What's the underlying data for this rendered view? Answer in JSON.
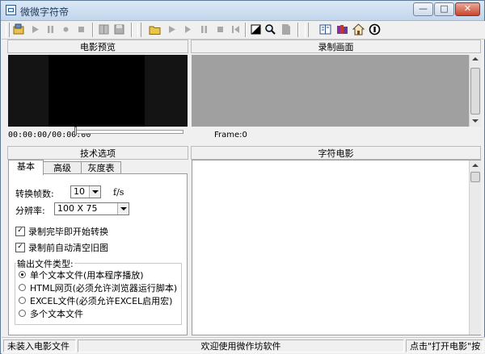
{
  "window": {
    "title": "微微字符帝"
  },
  "toolbar": {
    "left_group": [
      "open-video-icon",
      "play-icon",
      "pause-icon",
      "record-icon",
      "stop-icon",
      "grid-view-icon",
      "save-icon"
    ],
    "middle_group": [
      "open-folder-icon",
      "play-icon",
      "step-icon",
      "pause-icon",
      "next-frame-icon",
      "stop-icon",
      "prev-frame-icon",
      "contrast-icon",
      "zoom-icon",
      "page-icon"
    ],
    "right_group": [
      "help-book-icon",
      "books-icon",
      "home-icon",
      "web-icon"
    ]
  },
  "panels": {
    "preview_title": "电影预览",
    "record_title": "录制画面",
    "options_title": "技术选项",
    "char_movie_title": "字符电影"
  },
  "preview": {
    "time": "00:00:00/00:00:00",
    "frame": "Frame:0"
  },
  "tabs": [
    "基本",
    "高级",
    "灰度表"
  ],
  "options": {
    "fps_label": "转换帧数:",
    "fps_value": "10",
    "fps_unit": "f/s",
    "res_label": "分辨率:",
    "res_value": "100 X 75",
    "chk_auto_convert": "录制完毕即开始转换",
    "chk_auto_clear": "录制前自动清空旧图",
    "output_type_label": "输出文件类型:",
    "output_types": [
      "单个文本文件(用本程序播放)",
      "HTML网页(必须允许浏览器运行脚本)",
      "EXCEL文件(必须允许EXCEL启用宏)",
      "多个文本文件"
    ]
  },
  "status": {
    "left": "未装入电影文件",
    "center": "欢迎使用微作坊软件",
    "right": "点击\"打开电影\"按"
  }
}
